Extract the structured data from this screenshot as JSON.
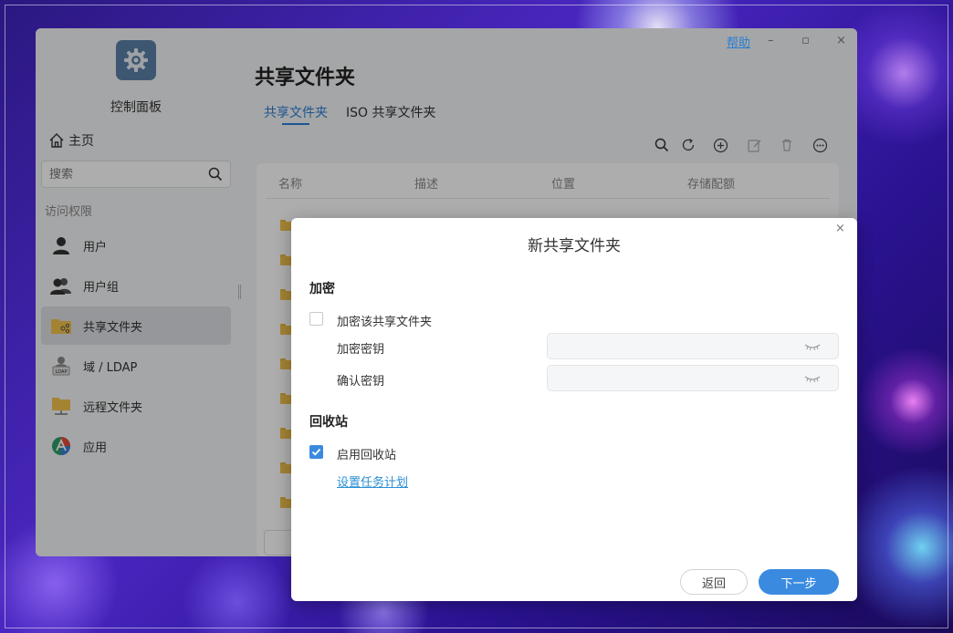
{
  "window": {
    "help_label": "帮助",
    "minimize": "–",
    "maximize": "▫",
    "close": "×"
  },
  "sidebar": {
    "app_title": "控制面板",
    "home_label": "主页",
    "search_placeholder": "搜索",
    "section_label": "访问权限",
    "items": [
      {
        "label": "用户",
        "icon": "user-icon"
      },
      {
        "label": "用户组",
        "icon": "user-group-icon"
      },
      {
        "label": "共享文件夹",
        "icon": "shared-folder-icon",
        "active": true
      },
      {
        "label": "域 / LDAP",
        "icon": "ldap-icon"
      },
      {
        "label": "远程文件夹",
        "icon": "remote-folder-icon"
      },
      {
        "label": "应用",
        "icon": "app-icon"
      }
    ]
  },
  "main": {
    "title": "共享文件夹",
    "tabs": [
      {
        "label": "共享文件夹",
        "active": true
      },
      {
        "label": "ISO 共享文件夹",
        "active": false
      }
    ],
    "toolbar": [
      "search-icon",
      "refresh-icon",
      "add-icon",
      "edit-icon",
      "delete-icon",
      "more-icon"
    ],
    "table": {
      "columns": [
        "名称",
        "描述",
        "位置",
        "存储配额"
      ]
    }
  },
  "dialog": {
    "title": "新共享文件夹",
    "close": "×",
    "encryption": {
      "section": "加密",
      "checkbox_label": "加密该共享文件夹",
      "checked": false,
      "key_label": "加密密钥",
      "confirm_label": "确认密钥",
      "key_value": "",
      "confirm_value": ""
    },
    "recycle": {
      "section": "回收站",
      "checkbox_label": "启用回收站",
      "checked": true,
      "schedule_link": "设置任务计划"
    },
    "buttons": {
      "back": "返回",
      "next": "下一步"
    },
    "accent_color": "#3a8be0"
  }
}
